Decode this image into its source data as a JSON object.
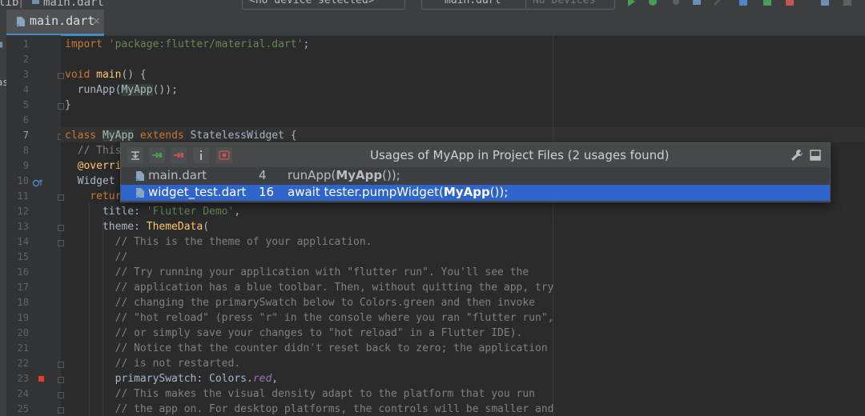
{
  "toolbar": {
    "breadcrumb_dir": "lib",
    "breadcrumb_file": "main.dart",
    "device_selector": "<no device selected>",
    "run_config": "main.dart",
    "devices": "No Devices"
  },
  "tab": {
    "label": "main.dart",
    "close": "×"
  },
  "left_strip": {
    "label": "as"
  },
  "code_lines": [
    {
      "n": "1",
      "t": [
        [
          "kw",
          "import "
        ],
        [
          "str",
          "'package:flutter/material.dart'"
        ],
        [
          "",
          "; "
        ]
      ]
    },
    {
      "n": "2",
      "t": []
    },
    {
      "n": "3",
      "t": [
        [
          "kw",
          "void "
        ],
        [
          "cls",
          "main"
        ],
        [
          "",
          "() {"
        ]
      ]
    },
    {
      "n": "4",
      "t": [
        [
          "",
          "  runApp("
        ],
        [
          "hl",
          "MyApp"
        ],
        [
          "",
          "());"
        ]
      ]
    },
    {
      "n": "5",
      "t": [
        [
          "",
          "}"
        ]
      ]
    },
    {
      "n": "6",
      "t": []
    },
    {
      "n": "7",
      "t": [
        [
          "kw",
          "class "
        ],
        [
          "hl",
          "MyApp"
        ],
        [
          "kw",
          " extends "
        ],
        [
          "",
          "StatelessWidget {"
        ]
      ]
    },
    {
      "n": "8",
      "t": [
        [
          "cm",
          "  // This"
        ]
      ]
    },
    {
      "n": "9",
      "t": [
        [
          "cls",
          "  @overri"
        ]
      ]
    },
    {
      "n": "10",
      "t": [
        [
          "",
          "  Widget "
        ]
      ]
    },
    {
      "n": "11",
      "t": [
        [
          "kw",
          "    retur"
        ]
      ]
    },
    {
      "n": "12",
      "t": [
        [
          "",
          "      title: "
        ],
        [
          "str",
          "'Flutter Demo'"
        ],
        [
          "",
          ","
        ]
      ]
    },
    {
      "n": "13",
      "t": [
        [
          "",
          "      theme: "
        ],
        [
          "cls",
          "ThemeData"
        ],
        [
          "",
          "("
        ]
      ]
    },
    {
      "n": "14",
      "t": [
        [
          "cm",
          "        // This is the theme of your application."
        ]
      ]
    },
    {
      "n": "15",
      "t": [
        [
          "cm",
          "        //"
        ]
      ]
    },
    {
      "n": "16",
      "t": [
        [
          "cm",
          "        // Try running your application with \"flutter run\". You'll see the"
        ]
      ]
    },
    {
      "n": "17",
      "t": [
        [
          "cm",
          "        // application has a blue toolbar. Then, without quitting the app, try"
        ]
      ]
    },
    {
      "n": "18",
      "t": [
        [
          "cm",
          "        // changing the primarySwatch below to Colors.green and then invoke"
        ]
      ]
    },
    {
      "n": "19",
      "t": [
        [
          "cm",
          "        // \"hot reload\" (press \"r\" in the console where you ran \"flutter run\","
        ]
      ]
    },
    {
      "n": "20",
      "t": [
        [
          "cm",
          "        // or simply save your changes to \"hot reload\" in a Flutter IDE)."
        ]
      ]
    },
    {
      "n": "21",
      "t": [
        [
          "cm",
          "        // Notice that the counter didn't reset back to zero; the application"
        ]
      ]
    },
    {
      "n": "22",
      "t": [
        [
          "cm",
          "        // is not restarted."
        ]
      ]
    },
    {
      "n": "23",
      "t": [
        [
          "",
          "        primarySwatch: Colors."
        ],
        [
          "it",
          "red"
        ],
        [
          "",
          ","
        ]
      ]
    },
    {
      "n": "24",
      "t": [
        [
          "cm",
          "        // This makes the visual density adapt to the platform that you run"
        ]
      ]
    },
    {
      "n": "25",
      "t": [
        [
          "cm",
          "        // the app on. For desktop platforms, the controls will be smaller and"
        ]
      ]
    }
  ],
  "current_line": "7",
  "usages": {
    "title": "Usages of MyApp in Project Files (2 usages found)",
    "rows": [
      {
        "file": "main.dart",
        "line": "4",
        "before": "runApp(",
        "match": "MyApp",
        "after": "());",
        "selected": false
      },
      {
        "file": "widget_test.dart",
        "line": "16",
        "before": "await tester.pumpWidget(",
        "match": "MyApp",
        "after": "());",
        "selected": true
      }
    ]
  },
  "colors": {
    "accent": "#2f65ca",
    "background": "#2b2b2b",
    "keyword": "#cc7832",
    "string": "#6a8759",
    "comment": "#808080"
  }
}
